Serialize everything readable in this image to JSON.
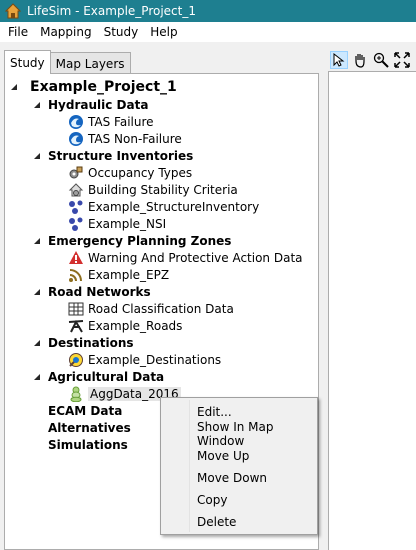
{
  "window": {
    "title": "LifeSim - Example_Project_1",
    "accent": "#1e7f90"
  },
  "menu": [
    "File",
    "Mapping",
    "Study",
    "Help"
  ],
  "tabs": [
    "Study",
    "Map Layers"
  ],
  "map_tools": [
    "pointer-icon",
    "pan-hand-icon",
    "zoom-in-icon",
    "zoom-extent-icon"
  ],
  "tree": {
    "root": "Example_Project_1",
    "hydraulic": {
      "label": "Hydraulic Data",
      "items": [
        "TAS Failure",
        "TAS Non-Failure"
      ]
    },
    "structure": {
      "label": "Structure Inventories",
      "items": [
        "Occupancy Types",
        "Building Stability Criteria",
        "Example_StructureInventory",
        "Example_NSI"
      ]
    },
    "emergency": {
      "label": "Emergency Planning Zones",
      "items": [
        "Warning And Protective Action Data",
        "Example_EPZ"
      ]
    },
    "road": {
      "label": "Road Networks",
      "items": [
        "Road Classification Data",
        "Example_Roads"
      ]
    },
    "destinations": {
      "label": "Destinations",
      "items": [
        "Example_Destinations"
      ]
    },
    "agricultural": {
      "label": "Agricultural Data",
      "items": [
        "AggData_2016"
      ]
    },
    "ecam": "ECAM Data",
    "alternatives": "Alternatives",
    "simulations": "Simulations"
  },
  "context_menu": [
    "Edit...",
    "Show In Map Window",
    "Move Up",
    "Move Down",
    "Copy",
    "Delete"
  ]
}
